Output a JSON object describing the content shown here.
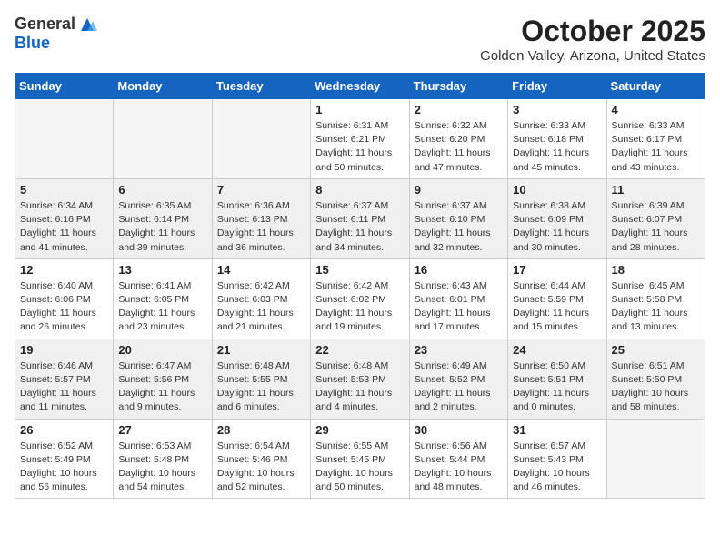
{
  "header": {
    "logo": {
      "general": "General",
      "blue": "Blue"
    },
    "month": "October 2025",
    "location": "Golden Valley, Arizona, United States"
  },
  "weekdays": [
    "Sunday",
    "Monday",
    "Tuesday",
    "Wednesday",
    "Thursday",
    "Friday",
    "Saturday"
  ],
  "weeks": [
    {
      "shaded": false,
      "days": [
        {
          "num": "",
          "info": ""
        },
        {
          "num": "",
          "info": ""
        },
        {
          "num": "",
          "info": ""
        },
        {
          "num": "1",
          "info": "Sunrise: 6:31 AM\nSunset: 6:21 PM\nDaylight: 11 hours\nand 50 minutes."
        },
        {
          "num": "2",
          "info": "Sunrise: 6:32 AM\nSunset: 6:20 PM\nDaylight: 11 hours\nand 47 minutes."
        },
        {
          "num": "3",
          "info": "Sunrise: 6:33 AM\nSunset: 6:18 PM\nDaylight: 11 hours\nand 45 minutes."
        },
        {
          "num": "4",
          "info": "Sunrise: 6:33 AM\nSunset: 6:17 PM\nDaylight: 11 hours\nand 43 minutes."
        }
      ]
    },
    {
      "shaded": true,
      "days": [
        {
          "num": "5",
          "info": "Sunrise: 6:34 AM\nSunset: 6:16 PM\nDaylight: 11 hours\nand 41 minutes."
        },
        {
          "num": "6",
          "info": "Sunrise: 6:35 AM\nSunset: 6:14 PM\nDaylight: 11 hours\nand 39 minutes."
        },
        {
          "num": "7",
          "info": "Sunrise: 6:36 AM\nSunset: 6:13 PM\nDaylight: 11 hours\nand 36 minutes."
        },
        {
          "num": "8",
          "info": "Sunrise: 6:37 AM\nSunset: 6:11 PM\nDaylight: 11 hours\nand 34 minutes."
        },
        {
          "num": "9",
          "info": "Sunrise: 6:37 AM\nSunset: 6:10 PM\nDaylight: 11 hours\nand 32 minutes."
        },
        {
          "num": "10",
          "info": "Sunrise: 6:38 AM\nSunset: 6:09 PM\nDaylight: 11 hours\nand 30 minutes."
        },
        {
          "num": "11",
          "info": "Sunrise: 6:39 AM\nSunset: 6:07 PM\nDaylight: 11 hours\nand 28 minutes."
        }
      ]
    },
    {
      "shaded": false,
      "days": [
        {
          "num": "12",
          "info": "Sunrise: 6:40 AM\nSunset: 6:06 PM\nDaylight: 11 hours\nand 26 minutes."
        },
        {
          "num": "13",
          "info": "Sunrise: 6:41 AM\nSunset: 6:05 PM\nDaylight: 11 hours\nand 23 minutes."
        },
        {
          "num": "14",
          "info": "Sunrise: 6:42 AM\nSunset: 6:03 PM\nDaylight: 11 hours\nand 21 minutes."
        },
        {
          "num": "15",
          "info": "Sunrise: 6:42 AM\nSunset: 6:02 PM\nDaylight: 11 hours\nand 19 minutes."
        },
        {
          "num": "16",
          "info": "Sunrise: 6:43 AM\nSunset: 6:01 PM\nDaylight: 11 hours\nand 17 minutes."
        },
        {
          "num": "17",
          "info": "Sunrise: 6:44 AM\nSunset: 5:59 PM\nDaylight: 11 hours\nand 15 minutes."
        },
        {
          "num": "18",
          "info": "Sunrise: 6:45 AM\nSunset: 5:58 PM\nDaylight: 11 hours\nand 13 minutes."
        }
      ]
    },
    {
      "shaded": true,
      "days": [
        {
          "num": "19",
          "info": "Sunrise: 6:46 AM\nSunset: 5:57 PM\nDaylight: 11 hours\nand 11 minutes."
        },
        {
          "num": "20",
          "info": "Sunrise: 6:47 AM\nSunset: 5:56 PM\nDaylight: 11 hours\nand 9 minutes."
        },
        {
          "num": "21",
          "info": "Sunrise: 6:48 AM\nSunset: 5:55 PM\nDaylight: 11 hours\nand 6 minutes."
        },
        {
          "num": "22",
          "info": "Sunrise: 6:48 AM\nSunset: 5:53 PM\nDaylight: 11 hours\nand 4 minutes."
        },
        {
          "num": "23",
          "info": "Sunrise: 6:49 AM\nSunset: 5:52 PM\nDaylight: 11 hours\nand 2 minutes."
        },
        {
          "num": "24",
          "info": "Sunrise: 6:50 AM\nSunset: 5:51 PM\nDaylight: 11 hours\nand 0 minutes."
        },
        {
          "num": "25",
          "info": "Sunrise: 6:51 AM\nSunset: 5:50 PM\nDaylight: 10 hours\nand 58 minutes."
        }
      ]
    },
    {
      "shaded": false,
      "days": [
        {
          "num": "26",
          "info": "Sunrise: 6:52 AM\nSunset: 5:49 PM\nDaylight: 10 hours\nand 56 minutes."
        },
        {
          "num": "27",
          "info": "Sunrise: 6:53 AM\nSunset: 5:48 PM\nDaylight: 10 hours\nand 54 minutes."
        },
        {
          "num": "28",
          "info": "Sunrise: 6:54 AM\nSunset: 5:46 PM\nDaylight: 10 hours\nand 52 minutes."
        },
        {
          "num": "29",
          "info": "Sunrise: 6:55 AM\nSunset: 5:45 PM\nDaylight: 10 hours\nand 50 minutes."
        },
        {
          "num": "30",
          "info": "Sunrise: 6:56 AM\nSunset: 5:44 PM\nDaylight: 10 hours\nand 48 minutes."
        },
        {
          "num": "31",
          "info": "Sunrise: 6:57 AM\nSunset: 5:43 PM\nDaylight: 10 hours\nand 46 minutes."
        },
        {
          "num": "",
          "info": ""
        }
      ]
    }
  ]
}
